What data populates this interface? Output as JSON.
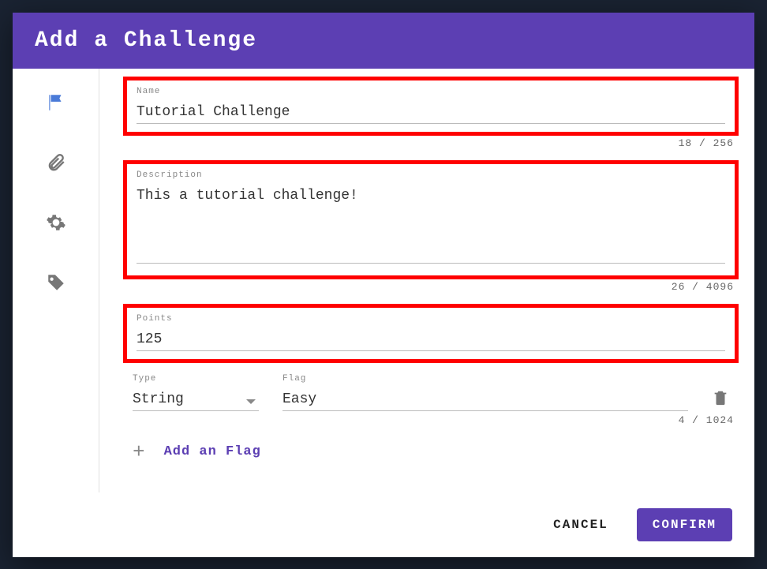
{
  "modal": {
    "title": "Add a Challenge"
  },
  "fields": {
    "name": {
      "label": "Name",
      "value": "Tutorial Challenge",
      "counter": "18 / 256"
    },
    "description": {
      "label": "Description",
      "value": "This a tutorial challenge!",
      "counter": "26 / 4096"
    },
    "points": {
      "label": "Points",
      "value": "125"
    }
  },
  "flag": {
    "type_label": "Type",
    "type_value": "String",
    "flag_label": "Flag",
    "flag_value": "Easy",
    "counter": "4 / 1024",
    "add_label": "Add an Flag"
  },
  "footer": {
    "cancel": "CANCEL",
    "confirm": "CONFIRM"
  },
  "icons": {
    "flag": "flag-icon",
    "attachment": "paperclip-icon",
    "settings": "gear-icon",
    "tag": "tag-icon",
    "delete": "trash-icon",
    "plus": "plus-icon"
  }
}
